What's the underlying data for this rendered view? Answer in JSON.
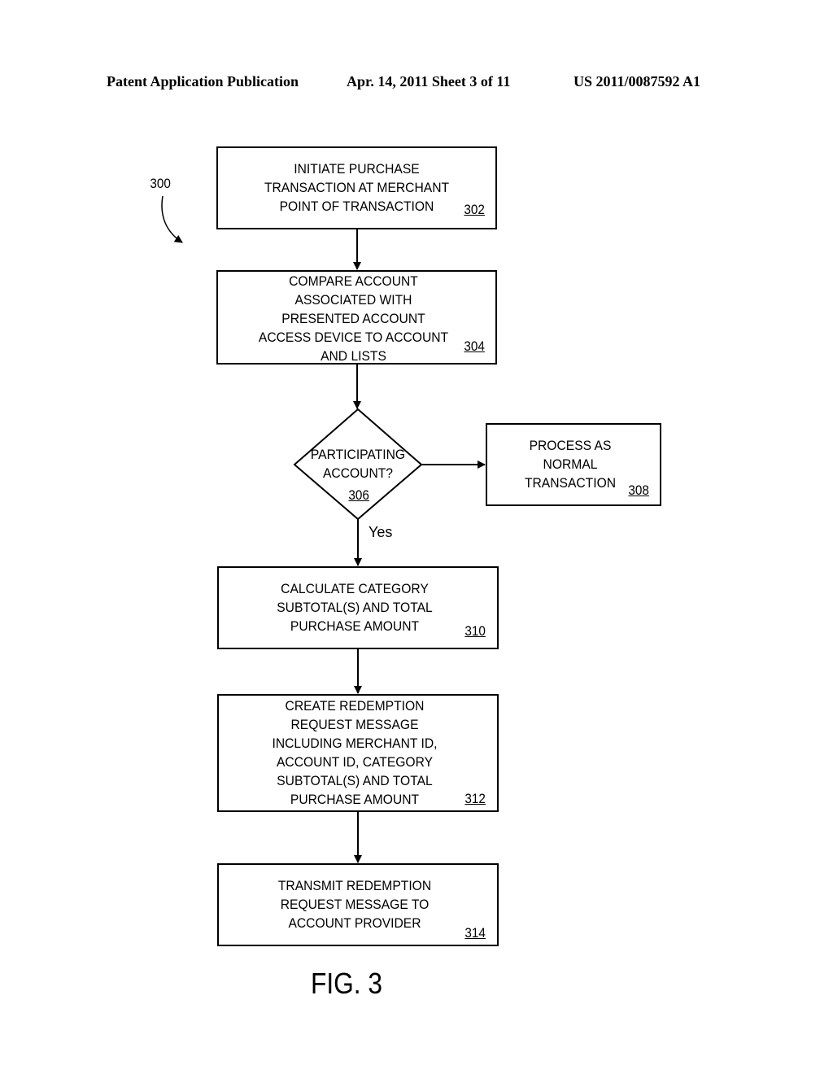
{
  "header": {
    "left": "Patent Application Publication",
    "middle": "Apr. 14, 2011  Sheet 3 of 11",
    "right": "US 2011/0087592 A1"
  },
  "figure": {
    "ref": "300",
    "caption": "FIG. 3",
    "yes_label": "Yes",
    "nodes": [
      {
        "id": "302",
        "type": "process",
        "lines": [
          "INITIATE PURCHASE",
          "TRANSACTION AT MERCHANT",
          "POINT OF TRANSACTION"
        ]
      },
      {
        "id": "304",
        "type": "process",
        "lines": [
          "COMPARE ACCOUNT",
          "ASSOCIATED WITH",
          "PRESENTED ACCOUNT",
          "ACCESS DEVICE TO ACCOUNT",
          "AND LISTS"
        ]
      },
      {
        "id": "306",
        "type": "decision",
        "lines": [
          "PARTICIPATING",
          "ACCOUNT?"
        ]
      },
      {
        "id": "308",
        "type": "process",
        "lines": [
          "PROCESS AS",
          "NORMAL",
          "TRANSACTION"
        ]
      },
      {
        "id": "310",
        "type": "process",
        "lines": [
          "CALCULATE CATEGORY",
          "SUBTOTAL(S) AND TOTAL",
          "PURCHASE AMOUNT"
        ]
      },
      {
        "id": "312",
        "type": "process",
        "lines": [
          "CREATE REDEMPTION",
          "REQUEST MESSAGE",
          "INCLUDING MERCHANT ID,",
          "ACCOUNT ID, CATEGORY",
          "SUBTOTAL(S) AND TOTAL",
          "PURCHASE AMOUNT"
        ]
      },
      {
        "id": "314",
        "type": "process",
        "lines": [
          "TRANSMIT REDEMPTION",
          "REQUEST MESSAGE TO",
          "ACCOUNT PROVIDER"
        ]
      }
    ],
    "edges": [
      {
        "from": "302",
        "to": "304",
        "label": ""
      },
      {
        "from": "304",
        "to": "306",
        "label": ""
      },
      {
        "from": "306",
        "to": "308",
        "label": ""
      },
      {
        "from": "306",
        "to": "310",
        "label": "Yes"
      },
      {
        "from": "310",
        "to": "312",
        "label": ""
      },
      {
        "from": "312",
        "to": "314",
        "label": ""
      }
    ]
  }
}
